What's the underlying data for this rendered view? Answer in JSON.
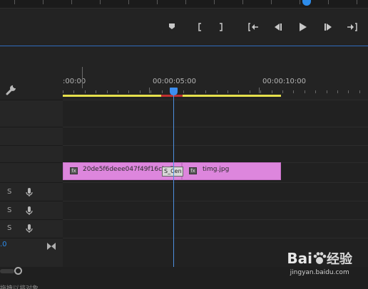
{
  "monitor": {
    "transport_buttons": [
      {
        "icon": "add-marker-icon"
      },
      {
        "icon": "mark-in-icon"
      },
      {
        "icon": "mark-out-icon"
      },
      {
        "icon": "go-to-in-icon"
      },
      {
        "icon": "step-back-icon"
      },
      {
        "icon": "play-icon"
      },
      {
        "icon": "step-forward-icon"
      },
      {
        "icon": "go-to-out-icon"
      }
    ]
  },
  "timeline": {
    "ruler_labels": [
      ":00:00",
      "00:00:05:00",
      "00:00:10:00"
    ],
    "clips": [
      {
        "name": "20de5f6deee047f49f16cbe5",
        "fx": "fx"
      },
      {
        "name": "timg.jpg",
        "fx": "fx"
      }
    ],
    "transition_label": "S_Cen",
    "audio_tracks": [
      {
        "solo": "S",
        "icon": "microphone-icon"
      },
      {
        "solo": "S",
        "icon": "microphone-icon"
      },
      {
        "solo": "S",
        "icon": "microphone-icon"
      }
    ],
    "master_value": ".0",
    "status_text": "拖拽以将对象"
  },
  "watermark": {
    "brand_latin": "Bai",
    "brand_cn": "经验",
    "url": "jingyan.baidu.com"
  },
  "colors": {
    "accent": "#2d8ceb",
    "work_area": "#e6e04c",
    "clip": "#dd86dd"
  }
}
